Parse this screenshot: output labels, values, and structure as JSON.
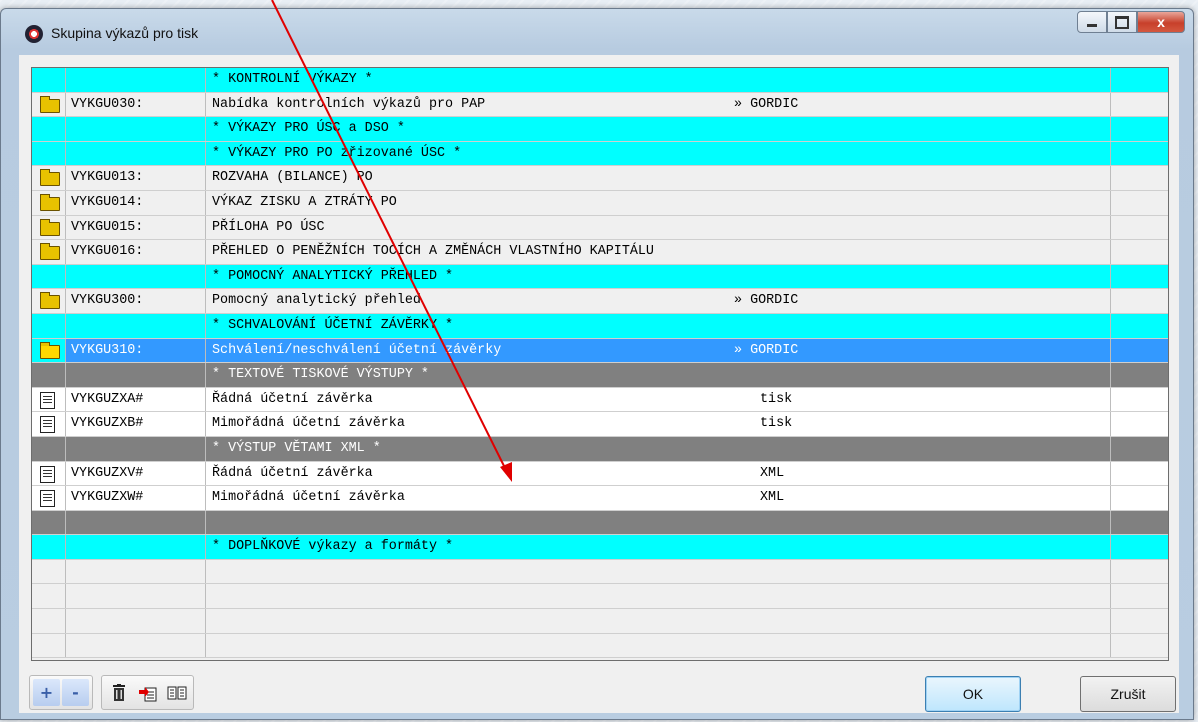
{
  "window": {
    "title": "Skupina výkazů pro tisk",
    "close_glyph": "x"
  },
  "rows": [
    {
      "style": "cyan",
      "icon": "",
      "code": "",
      "desc": "* KONTROLNÍ VÝKAZY *",
      "tag": ""
    },
    {
      "style": "light",
      "icon": "folder",
      "code": "VYKGU030:",
      "desc": "Nabídka kontrolních výkazů pro PAP",
      "tag": "» GORDIC"
    },
    {
      "style": "cyan",
      "icon": "",
      "code": "",
      "desc": "* VÝKAZY PRO ÚSC a DSO *",
      "tag": ""
    },
    {
      "style": "cyan",
      "icon": "",
      "code": "",
      "desc": "* VÝKAZY PRO PO zřizované ÚSC *",
      "tag": ""
    },
    {
      "style": "light",
      "icon": "folder",
      "code": "VYKGU013:",
      "desc": "ROZVAHA (BILANCE) PO",
      "tag": ""
    },
    {
      "style": "light",
      "icon": "folder",
      "code": "VYKGU014:",
      "desc": "VÝKAZ ZISKU A ZTRÁTY PO",
      "tag": ""
    },
    {
      "style": "light",
      "icon": "folder",
      "code": "VYKGU015:",
      "desc": "PŘÍLOHA PO ÚSC",
      "tag": ""
    },
    {
      "style": "light",
      "icon": "folder",
      "code": "VYKGU016:",
      "desc": "PŘEHLED O PENĚŽNÍCH TOCÍCH A ZMĚNÁCH VLASTNÍHO KAPITÁLU",
      "tag": ""
    },
    {
      "style": "cyan",
      "icon": "",
      "code": "",
      "desc": "* POMOCNÝ ANALYTICKÝ PŘEHLED *",
      "tag": ""
    },
    {
      "style": "light",
      "icon": "folder",
      "code": "VYKGU300:",
      "desc": "Pomocný analytický přehled",
      "tag": "» GORDIC"
    },
    {
      "style": "cyan",
      "icon": "",
      "code": "",
      "desc": "* SCHVALOVÁNÍ ÚČETNÍ ZÁVĚRKY *",
      "tag": ""
    },
    {
      "style": "selected",
      "icon": "folder-open",
      "code": "VYKGU310:",
      "desc": "Schválení/neschválení účetní závěrky",
      "tag": "» GORDIC"
    },
    {
      "style": "gray",
      "icon": "",
      "code": "",
      "desc": "* TEXTOVÉ TISKOVÉ VÝSTUPY *",
      "tag": ""
    },
    {
      "style": "white",
      "icon": "doc",
      "code": "VYKGUZXA#",
      "desc": "Řádná účetní závěrka",
      "tag": "tisk"
    },
    {
      "style": "white",
      "icon": "doc",
      "code": "VYKGUZXB#",
      "desc": "Mimořádná účetní závěrka",
      "tag": "tisk"
    },
    {
      "style": "gray",
      "icon": "",
      "code": "",
      "desc": "* VÝSTUP VĚTAMI XML *",
      "tag": ""
    },
    {
      "style": "white",
      "icon": "doc",
      "code": "VYKGUZXV#",
      "desc": "Řádná účetní závěrka",
      "tag": "XML"
    },
    {
      "style": "white",
      "icon": "doc",
      "code": "VYKGUZXW#",
      "desc": "Mimořádná účetní závěrka",
      "tag": "XML"
    },
    {
      "style": "gray",
      "icon": "",
      "code": "",
      "desc": "",
      "tag": ""
    },
    {
      "style": "cyan",
      "icon": "",
      "code": "",
      "desc": "* DOPLŇKOVÉ výkazy a formáty *",
      "tag": ""
    },
    {
      "style": "light",
      "icon": "",
      "code": "",
      "desc": "",
      "tag": ""
    },
    {
      "style": "light",
      "icon": "",
      "code": "",
      "desc": "",
      "tag": ""
    },
    {
      "style": "light",
      "icon": "",
      "code": "",
      "desc": "",
      "tag": ""
    },
    {
      "style": "light",
      "icon": "",
      "code": "",
      "desc": "",
      "tag": ""
    }
  ],
  "toolbar": {
    "add_label": "+",
    "remove_label": "-",
    "delete_icon": "trash-icon",
    "copy_icon": "copy-icon",
    "book_icon": "book-icon"
  },
  "buttons": {
    "ok_label": "OK",
    "cancel_label": "Zrušit"
  },
  "colors": {
    "header_row": "#00ffff",
    "selected_row": "#3399ff",
    "section_gray": "#808080",
    "annotation_arrow": "#e00000"
  }
}
